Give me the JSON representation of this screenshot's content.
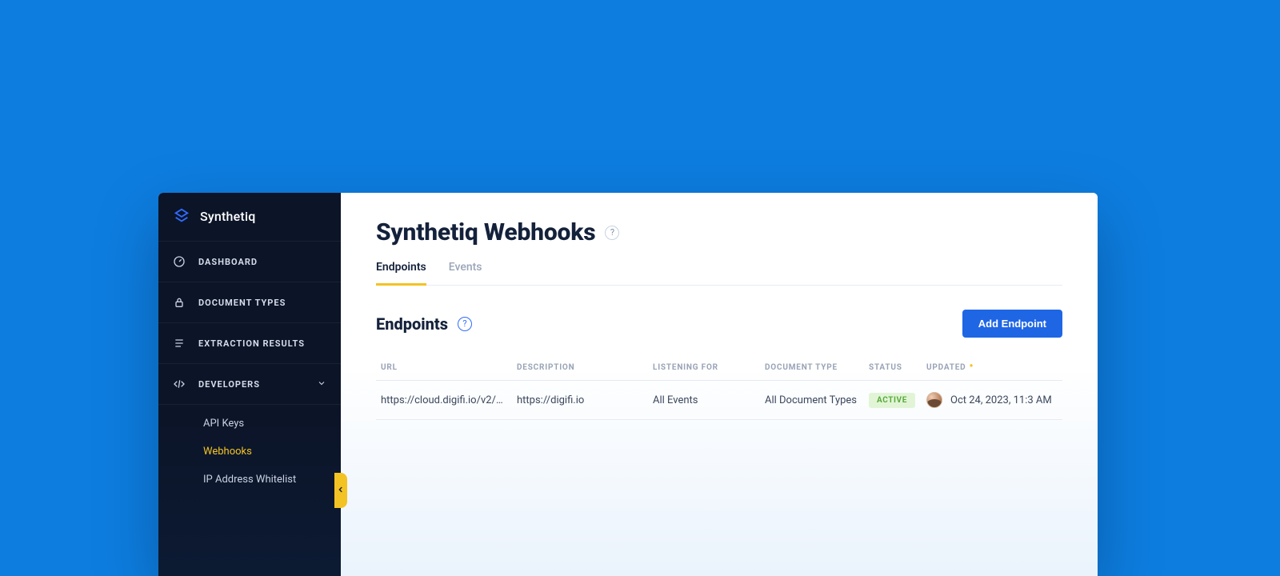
{
  "brand": {
    "name": "Synthetiq"
  },
  "sidebar": {
    "items": [
      {
        "label": "DASHBOARD"
      },
      {
        "label": "DOCUMENT TYPES"
      },
      {
        "label": "EXTRACTION RESULTS"
      },
      {
        "label": "DEVELOPERS"
      }
    ],
    "sub": [
      {
        "label": "API Keys"
      },
      {
        "label": "Webhooks"
      },
      {
        "label": "IP Address Whitelist"
      }
    ]
  },
  "page": {
    "title": "Synthetiq Webhooks",
    "tabs": [
      {
        "label": "Endpoints"
      },
      {
        "label": "Events"
      }
    ],
    "section_title": "Endpoints",
    "add_button": "Add Endpoint",
    "help_char": "?"
  },
  "table": {
    "headers": {
      "url": "URL",
      "description": "DESCRIPTION",
      "listening": "LISTENING FOR",
      "doctype": "DOCUMENT TYPE",
      "status": "STATUS",
      "updated": "UPDATED"
    },
    "rows": [
      {
        "url": "https://cloud.digifi.io/v2/eip/",
        "description": "https://digifi.io",
        "listening": "All Events",
        "doctype": "All Document Types",
        "status": "ACTIVE",
        "updated": "Oct 24, 2023, 11:3 AM"
      }
    ]
  }
}
